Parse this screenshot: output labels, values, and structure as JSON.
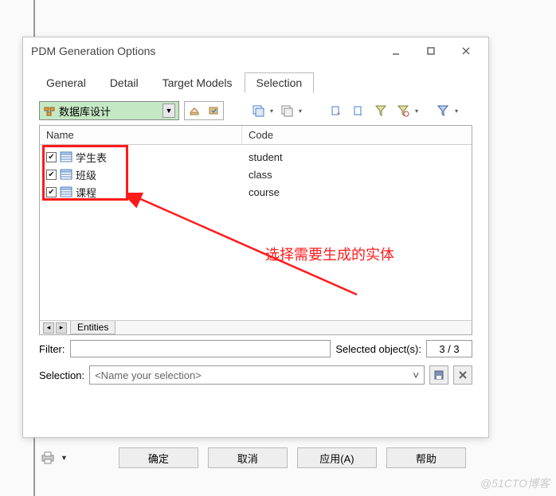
{
  "window": {
    "title": "PDM Generation Options"
  },
  "tabs": {
    "items": [
      "General",
      "Detail",
      "Target Models",
      "Selection"
    ],
    "active": 3
  },
  "model_dropdown": {
    "label": "数据库设计"
  },
  "columns": {
    "name": "Name",
    "code": "Code"
  },
  "rows": [
    {
      "name": "学生表",
      "code": "student",
      "checked": true
    },
    {
      "name": "班级",
      "code": "class",
      "checked": true
    },
    {
      "name": "课程",
      "code": "course",
      "checked": true
    }
  ],
  "footer_tab": "Entities",
  "filter": {
    "label": "Filter:",
    "value": "",
    "selected_label": "Selected object(s):",
    "selected_value": "3 / 3"
  },
  "selection": {
    "label": "Selection:",
    "placeholder": "<Name your selection>"
  },
  "buttons": {
    "ok": "确定",
    "cancel": "取消",
    "apply": "应用(A)",
    "help": "帮助"
  },
  "annotation": {
    "text": "选择需要生成的实体"
  },
  "watermark": "@51CTO博客"
}
